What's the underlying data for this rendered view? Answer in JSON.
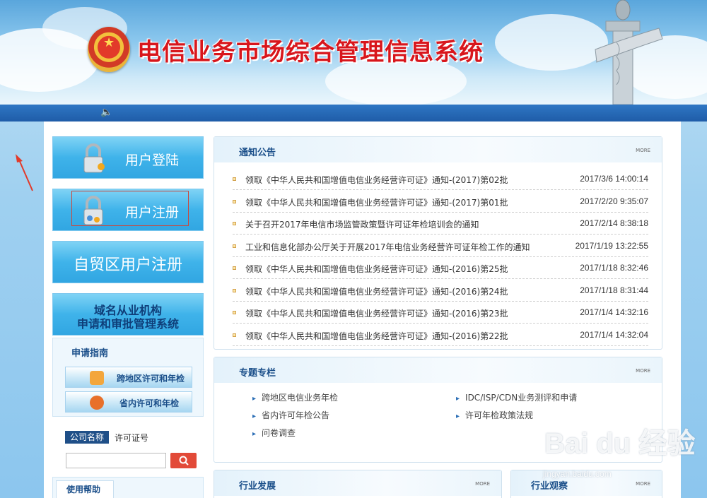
{
  "header": {
    "title": "电信业务市场综合管理信息系统",
    "emblem_icon": "national-emblem",
    "speaker_icon": "speaker-icon"
  },
  "left": {
    "login_label": "用户登陆",
    "register_label": "用户注册",
    "ftz_register_label": "自贸区用户注册",
    "domain_system_line1": "域名从业机构",
    "domain_system_line2": "申请和审批管理系统",
    "guide": {
      "title": "申请指南",
      "items": [
        "跨地区许可和年检",
        "省内许可和年检"
      ]
    },
    "search": {
      "tab_active": "公司名称",
      "tab_other": "许可证号",
      "input_value": "",
      "button_icon": "search-icon"
    },
    "help": {
      "title": "使用帮助"
    }
  },
  "notice": {
    "title": "通知公告",
    "more": "MORE",
    "items": [
      {
        "text": "领取《中华人民共和国增值电信业务经营许可证》通知-(2017)第02批",
        "date": "2017/3/6 14:00:14"
      },
      {
        "text": "领取《中华人民共和国增值电信业务经营许可证》通知-(2017)第01批",
        "date": "2017/2/20 9:35:07"
      },
      {
        "text": "关于召开2017年电信市场监管政策暨许可证年检培训会的通知",
        "date": "2017/2/14 8:38:18"
      },
      {
        "text": "工业和信息化部办公厅关于开展2017年电信业务经营许可证年检工作的通知",
        "date": "2017/1/19 13:22:55"
      },
      {
        "text": "领取《中华人民共和国增值电信业务经营许可证》通知-(2016)第25批",
        "date": "2017/1/18 8:32:46"
      },
      {
        "text": "领取《中华人民共和国增值电信业务经营许可证》通知-(2016)第24批",
        "date": "2017/1/18 8:31:44"
      },
      {
        "text": "领取《中华人民共和国增值电信业务经营许可证》通知-(2016)第23批",
        "date": "2017/1/4 14:32:16"
      },
      {
        "text": "领取《中华人民共和国增值电信业务经营许可证》通知-(2016)第22批",
        "date": "2017/1/4 14:32:04"
      }
    ]
  },
  "special": {
    "title": "专题专栏",
    "more": "MORE",
    "items": [
      "跨地区电信业务年检",
      "IDC/ISP/CDN业务测评和申请",
      "省内许可年检公告",
      "许可年检政策法规",
      "问卷调查"
    ]
  },
  "industry_dev": {
    "title": "行业发展",
    "more": "MORE"
  },
  "industry_watch": {
    "title": "行业观察",
    "more": "MORE"
  },
  "watermark": {
    "text": "Bai du 经验",
    "sub": "jingyan.baidu.com"
  }
}
